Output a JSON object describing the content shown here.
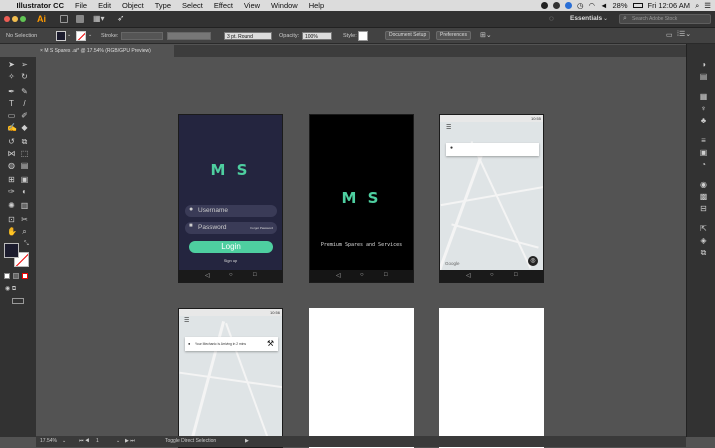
{
  "menubar": {
    "apple": "",
    "app_name": "Illustrator CC",
    "items": [
      "File",
      "Edit",
      "Object",
      "Type",
      "Select",
      "Effect",
      "View",
      "Window",
      "Help"
    ],
    "battery": "28%",
    "clock": "Fri 12:06 AM"
  },
  "appbar": {
    "logo": "Ai",
    "workspace": "Essentials",
    "search_placeholder": "Search Adobe Stock"
  },
  "controlbar": {
    "selection": "No Selection",
    "stroke_label": "Stroke:",
    "brush": "3 pt. Round",
    "opacity_label": "Opacity:",
    "opacity_value": "100%",
    "style_label": "Style:",
    "document_setup": "Document Setup",
    "preferences": "Preferences"
  },
  "tab": {
    "title": "M S Spares .ai* @ 17.54% (RGB/GPU Preview)"
  },
  "artboards": {
    "login": {
      "logo": "M S",
      "username": "Username",
      "password": "Password",
      "forgot": "Forgot Password",
      "login_btn": "Login",
      "signup": "Sign up"
    },
    "splash": {
      "logo": "M S",
      "tagline": "Premium Spares and Services"
    },
    "map2": {
      "time": "10:56",
      "banner": "Your Mechanic is Arriving in 2 mins"
    },
    "map1": {
      "time": "10:55",
      "google": "Google"
    }
  },
  "status": {
    "zoom": "17.54%",
    "page": "1",
    "tool": "Toggle Direct Selection"
  },
  "colors": {
    "accent_green": "#4ecfa0",
    "login_bg": "#24253f",
    "canvas": "#535353"
  }
}
